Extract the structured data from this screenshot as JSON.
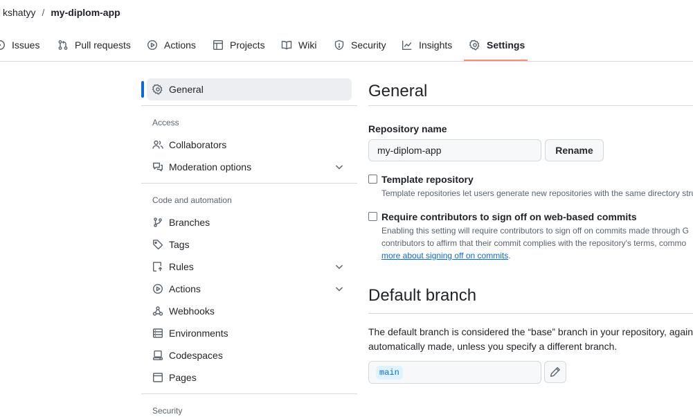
{
  "breadcrumb": {
    "owner": "kshatyy",
    "separator": "/",
    "repo": "my-diplom-app"
  },
  "tabs": [
    {
      "label": "Issues",
      "icon": "issue-opened-icon"
    },
    {
      "label": "Pull requests",
      "icon": "pull-request-icon"
    },
    {
      "label": "Actions",
      "icon": "play-icon"
    },
    {
      "label": "Projects",
      "icon": "table-icon"
    },
    {
      "label": "Wiki",
      "icon": "book-icon"
    },
    {
      "label": "Security",
      "icon": "shield-icon"
    },
    {
      "label": "Insights",
      "icon": "graph-icon"
    },
    {
      "label": "Settings",
      "icon": "gear-icon",
      "selected": true
    }
  ],
  "sidebar": {
    "general": "General",
    "sections": [
      {
        "heading": "Access",
        "items": [
          "Collaborators",
          "Moderation options"
        ]
      },
      {
        "heading": "Code and automation",
        "items": [
          "Branches",
          "Tags",
          "Rules",
          "Actions",
          "Webhooks",
          "Environments",
          "Codespaces",
          "Pages"
        ]
      },
      {
        "heading": "Security",
        "items": []
      }
    ]
  },
  "main": {
    "title": "General",
    "repo_name_label": "Repository name",
    "repo_name_value": "my-diplom-app",
    "rename_label": "Rename",
    "template": {
      "label": "Template repository",
      "description": "Template repositories let users generate new repositories with the same directory stru"
    },
    "signoff": {
      "label": "Require contributors to sign off on web-based commits",
      "desc_line1": "Enabling this setting will require contributors to sign off on commits made through G",
      "desc_line2": "contributors to affirm that their commit complies with the repository's terms, commo",
      "desc_link": "more about signing off on commits",
      "desc_end": "."
    },
    "default_branch": {
      "title": "Default branch",
      "line1": "The default branch is considered the “base” branch in your repository, agains",
      "line2": "automatically made, unless you specify a different branch.",
      "branch": "main"
    }
  },
  "colors": {
    "accent": "#0969da",
    "tab_underline": "#fd8c73",
    "border": "#d1d9e0",
    "muted": "#59636e"
  }
}
